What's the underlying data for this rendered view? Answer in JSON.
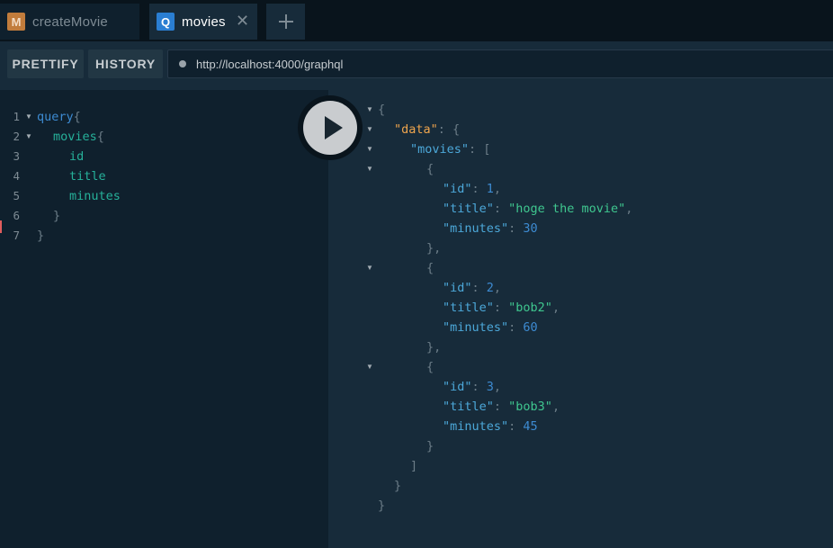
{
  "tabs": [
    {
      "badge": "M",
      "label": "createMovie",
      "active": false
    },
    {
      "badge": "Q",
      "label": "movies",
      "active": true,
      "close": "✕"
    }
  ],
  "add_tab": "+",
  "toolbar": {
    "prettify_label": "PRETTIFY",
    "history_label": "HISTORY",
    "endpoint_url": "http://localhost:4000/graphql"
  },
  "editor": {
    "line_numbers": [
      "1",
      "2",
      "3",
      "4",
      "5",
      "6",
      "7"
    ],
    "lines": {
      "l1_kw": "query",
      "l1_brace": "{",
      "l2_field": "movies",
      "l2_brace": "{",
      "l3_field": "id",
      "l4_field": "title",
      "l5_field": "minutes",
      "l6_brace": "}",
      "l7_brace": "}"
    }
  },
  "result": {
    "open_brace": "{",
    "data_key": "\"data\"",
    "colon_brace": ": {",
    "movies_key": "\"movies\"",
    "colon_bracket": ": [",
    "movies": [
      {
        "id": "1",
        "title": "\"hoge the movie\"",
        "minutes": "30"
      },
      {
        "id": "2",
        "title": "\"bob2\"",
        "minutes": "60"
      },
      {
        "id": "3",
        "title": "\"bob3\"",
        "minutes": "45"
      }
    ],
    "id_key": "\"id\"",
    "title_key": "\"title\"",
    "minutes_key": "\"minutes\""
  },
  "colors": {
    "background": "#0f202d",
    "accent_query": "#2a7ed2",
    "accent_mutation": "#c17c3c",
    "string": "#3fc78f",
    "number": "#3d8bd2",
    "data_key": "#eea44d"
  }
}
